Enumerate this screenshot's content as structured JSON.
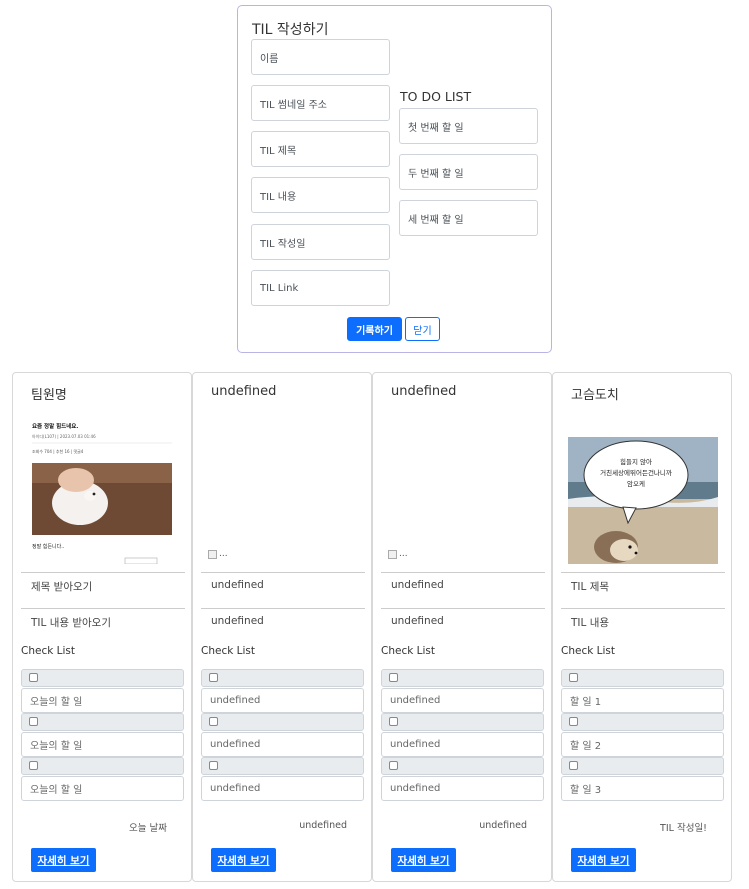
{
  "form": {
    "title": "TIL 작성하기",
    "left_fields": [
      "이름",
      "TIL 썸네일 주소",
      "TIL 제목",
      "TIL 내용",
      "TIL 작성일",
      "TIL Link"
    ],
    "todo_title": "TO DO LIST",
    "todo_fields": [
      "첫 번째 할 일",
      "두 번째 할 일",
      "세 번째 할 일"
    ],
    "submit_label": "기록하기",
    "close_label": "닫기"
  },
  "cards": [
    {
      "title": "팀원명",
      "thumbnail": "screenshot",
      "thumb_text": {
        "heading": "요즘 정말 힘드네요. ",
        "meta": "아이디(L107) | 2023.07.03 01:46",
        "stats": "조회수 704 | 추천 16 | 댓글4",
        "caption": "정말 힘든니다.."
      },
      "til_title": "제목 받아오기",
      "til_content": "TIL 내용 받아오기",
      "check_label": "Check List",
      "tasks": [
        "오늘의 할 일",
        "오늘의 할 일",
        "오늘의 할 일"
      ],
      "date": "오늘 날짜",
      "detail_label": "자세히 보기"
    },
    {
      "title": "undefined",
      "thumbnail": "broken",
      "broken_alt": "...",
      "til_title": "undefined",
      "til_content": "undefined",
      "check_label": "Check List",
      "tasks": [
        "undefined",
        "undefined",
        "undefined"
      ],
      "date": "undefined",
      "detail_label": "자세히 보기"
    },
    {
      "title": "undefined",
      "thumbnail": "broken",
      "broken_alt": "...",
      "til_title": "undefined",
      "til_content": "undefined",
      "check_label": "Check List",
      "tasks": [
        "undefined",
        "undefined",
        "undefined"
      ],
      "date": "undefined",
      "detail_label": "자세히 보기"
    },
    {
      "title": "고슴도치",
      "thumbnail": "hedgehog",
      "bubble_lines": [
        "힘들지 않아",
        "거친세상에뛰어든건나니까",
        "암오케"
      ],
      "til_title": "TIL 제목",
      "til_content": "TIL 내용",
      "check_label": "Check List",
      "tasks": [
        "할 일 1",
        "할 일 2",
        "할 일 3"
      ],
      "date": "TIL 작성일!",
      "detail_label": "자세히 보기"
    }
  ],
  "colors": {
    "primary": "#0d6efd",
    "form_border": "#b8b5e6",
    "check_bg": "#e9ecef"
  }
}
